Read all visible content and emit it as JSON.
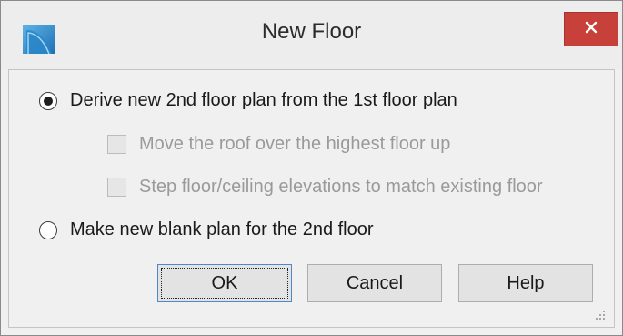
{
  "window": {
    "title": "New Floor",
    "close_icon": "close-icon",
    "app_icon": "chief-architect-app-icon"
  },
  "options": {
    "derive_label": "Derive new 2nd floor plan from the 1st floor plan",
    "derive_selected": true,
    "move_roof_label": "Move the roof over the highest floor up",
    "move_roof_checked": false,
    "move_roof_enabled": false,
    "step_elevations_label": "Step floor/ceiling elevations to match existing floor",
    "step_elevations_checked": false,
    "step_elevations_enabled": false,
    "blank_label": "Make new blank plan for the 2nd floor",
    "blank_selected": false
  },
  "buttons": {
    "ok": "OK",
    "cancel": "Cancel",
    "help": "Help"
  },
  "colors": {
    "close_button": "#c8403a",
    "default_button_border": "#4f88c8",
    "disabled_text": "#9a9a9a"
  }
}
